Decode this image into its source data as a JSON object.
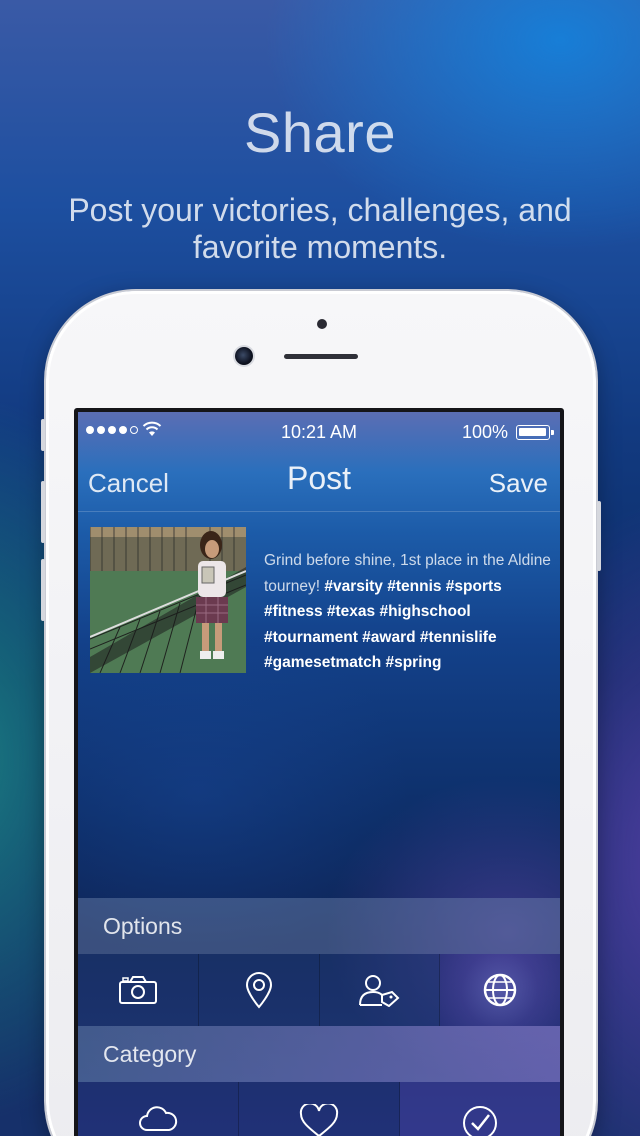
{
  "promo": {
    "title": "Share",
    "subtitle": "Post your victories, challenges, and favorite moments."
  },
  "status_bar": {
    "time": "10:21 AM",
    "battery": "100%"
  },
  "nav": {
    "cancel_label": "Cancel",
    "title": "Post",
    "save_label": "Save"
  },
  "post": {
    "caption_text": "Grind before shine, 1st place in the Aldine tourney!",
    "caption_tags": "#varsity #tennis #sports #fitness #texas #highschool #tournament #award #tennislife #gamesetmatch #spring"
  },
  "options": {
    "header": "Options",
    "icons": [
      "camera-icon",
      "location-pin-icon",
      "tag-person-icon",
      "globe-icon"
    ],
    "active_icon": "globe-icon"
  },
  "category": {
    "header": "Category",
    "icons": [
      "cloud-icon",
      "heart-icon",
      "checkmark-circle-icon"
    ]
  },
  "colors": {
    "tag_text": "#ffffff",
    "active_glow": "#a0a0ff"
  }
}
